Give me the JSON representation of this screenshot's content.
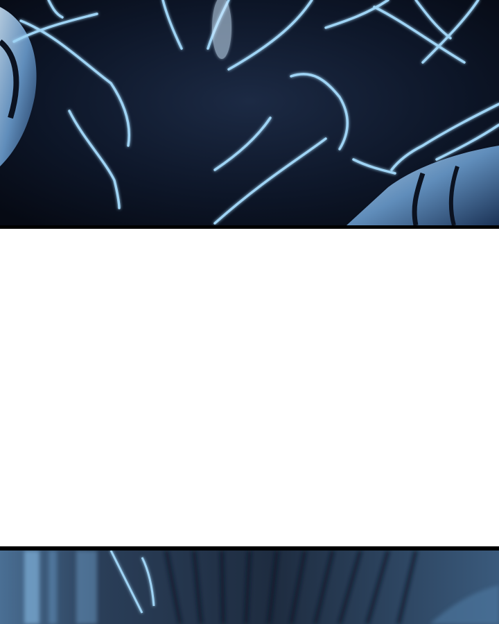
{
  "comic": {
    "panels": [
      {
        "id": "top-panel",
        "description_colors": {
          "background": "#0b1220",
          "glow": "#9fd4f5"
        }
      },
      {
        "id": "bottom-panel",
        "description_colors": {
          "background": "#1a2638",
          "glow": "#8fc3ea"
        }
      }
    ],
    "gutter_color": "#ffffff",
    "border_color": "#000000"
  }
}
